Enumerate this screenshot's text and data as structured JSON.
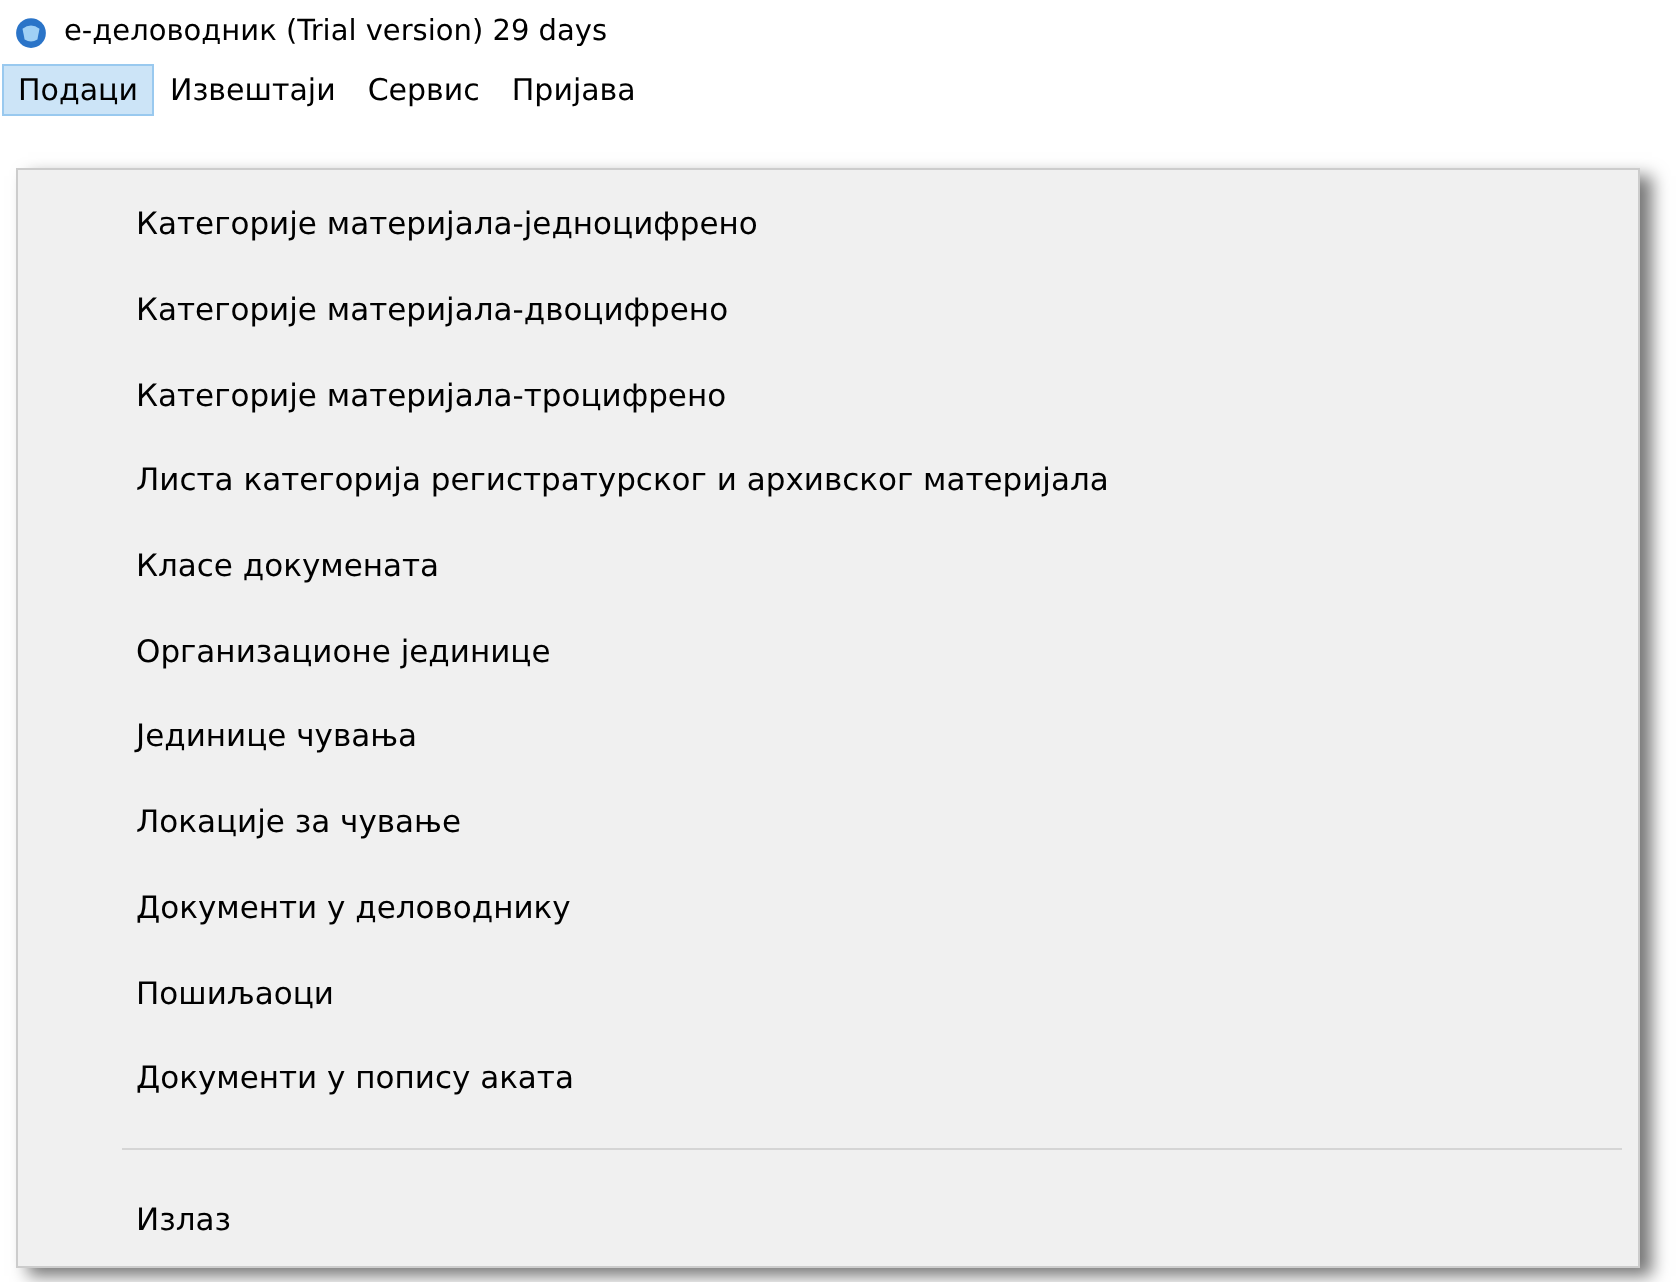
{
  "window": {
    "title": "е-деловодник (Trial version) 29 days"
  },
  "menu_bar": [
    {
      "label": "Подаци",
      "selected": true
    },
    {
      "label": "Извештаји",
      "selected": false
    },
    {
      "label": "Сервис",
      "selected": false
    },
    {
      "label": "Пријава",
      "selected": false
    }
  ],
  "dropdown": [
    {
      "kind": "item",
      "label": "Категорије материјала-једноцифрено"
    },
    {
      "kind": "item",
      "label": "Категорије материјала-двоцифрено"
    },
    {
      "kind": "item",
      "label": "Категорије материјала-троцифрено"
    },
    {
      "kind": "item",
      "label": "Листа категорија регистратурског и архивског материјала"
    },
    {
      "kind": "item",
      "label": "Класе докумената"
    },
    {
      "kind": "item",
      "label": "Организационе јединице"
    },
    {
      "kind": "item",
      "label": "Јединице чувања"
    },
    {
      "kind": "item",
      "label": "Локације за чување"
    },
    {
      "kind": "item",
      "label": "Документи у деловоднику"
    },
    {
      "kind": "item",
      "label": "Пошиљаоци"
    },
    {
      "kind": "item",
      "label": "Документи у попису аката"
    },
    {
      "kind": "separator"
    },
    {
      "kind": "item",
      "label": "Излаз"
    }
  ]
}
